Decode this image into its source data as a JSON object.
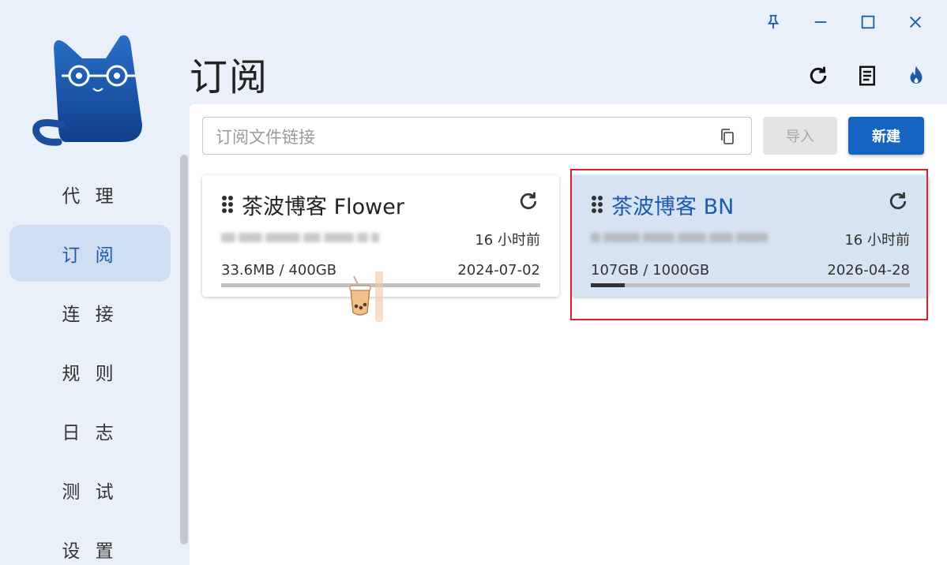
{
  "window": {
    "controls": [
      "pin-icon",
      "minimize-icon",
      "maximize-icon",
      "close-icon"
    ],
    "accent_color": "#1e5cab"
  },
  "sidebar": {
    "items": [
      {
        "label": "代 理",
        "active": false
      },
      {
        "label": "订 阅",
        "active": true
      },
      {
        "label": "连 接",
        "active": false
      },
      {
        "label": "规 则",
        "active": false
      },
      {
        "label": "日 志",
        "active": false
      },
      {
        "label": "测 试",
        "active": false
      },
      {
        "label": "设 置",
        "active": false
      }
    ]
  },
  "header": {
    "title": "订阅",
    "actions": [
      "refresh-icon",
      "document-icon",
      "fire-icon"
    ]
  },
  "toolbar": {
    "input_placeholder": "订阅文件链接",
    "input_value": "",
    "import_label": "导入",
    "new_label": "新建"
  },
  "profiles": [
    {
      "name": "茶波博客 Flower",
      "updated": "16 小时前",
      "usage": "33.6MB / 400GB",
      "expire": "2024-07-02",
      "usage_fraction": 0.0001,
      "selected": false
    },
    {
      "name": "茶波博客 BN",
      "updated": "16 小时前",
      "usage": "107GB / 1000GB",
      "expire": "2026-04-28",
      "usage_fraction": 0.107,
      "selected": true
    }
  ],
  "colors": {
    "primary_button": "#1565c0",
    "selected_card": "#d6e3f3",
    "highlight_border": "#d9202c",
    "page_background": "#e9f0f9"
  }
}
